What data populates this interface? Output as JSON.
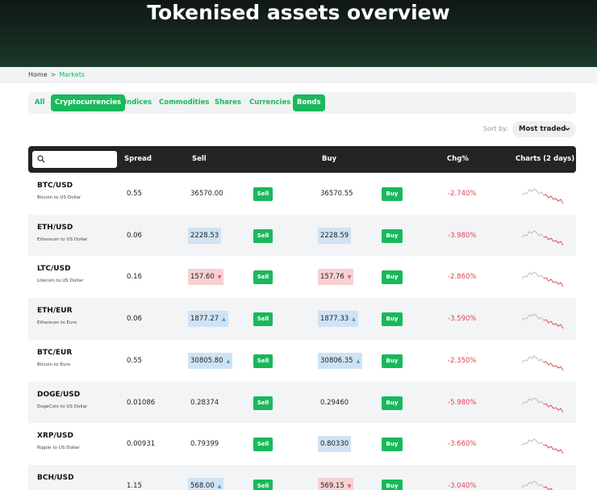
{
  "header": {
    "title": "Tokenised assets overview"
  },
  "breadcrumb": {
    "home": "Home",
    "separator": ">",
    "current": "Markets"
  },
  "tabs": [
    {
      "label": "All",
      "selected": false
    },
    {
      "label": "Cryptocurrencies",
      "selected": true
    },
    {
      "label": "Indices",
      "selected": false
    },
    {
      "label": "Commodities",
      "selected": false
    },
    {
      "label": "Shares",
      "selected": false
    },
    {
      "label": "Currencies",
      "selected": false
    },
    {
      "label": "Bonds",
      "selected": true
    }
  ],
  "sort": {
    "label": "Sort by:",
    "value": "Most traded",
    "icon": "chevron-down-icon"
  },
  "search": {
    "placeholder": "",
    "icon": "search-icon"
  },
  "columns": {
    "spread": "Spread",
    "sell": "Sell",
    "buy": "Buy",
    "chg": "Chg%",
    "charts": "Charts (2 days)"
  },
  "colors": {
    "accent": "#19b85b",
    "negative": "#e2434f",
    "up_highlight": "#cfe3f4",
    "down_highlight": "#f8d0d2"
  },
  "rows": [
    {
      "symbol": "BTC/USD",
      "description": "Bitcoin to US Dollar",
      "spread": "0.55",
      "sell": "36570.00",
      "sell_trend": "none",
      "sell_button": "Sell",
      "buy": "36570.55",
      "buy_trend": "none",
      "buy_button": "Buy",
      "chg": "-2.740%"
    },
    {
      "symbol": "ETH/USD",
      "description": "Ethereum to US Dollar",
      "spread": "0.06",
      "sell": "2228.53",
      "sell_trend": "flat",
      "sell_button": "Sell",
      "buy": "2228.59",
      "buy_trend": "flat",
      "buy_button": "Buy",
      "chg": "-3.980%"
    },
    {
      "symbol": "LTC/USD",
      "description": "Litecoin to US Dollar",
      "spread": "0.16",
      "sell": "157.60",
      "sell_trend": "down",
      "sell_button": "Sell",
      "buy": "157.76",
      "buy_trend": "down",
      "buy_button": "Buy",
      "chg": "-2.860%"
    },
    {
      "symbol": "ETH/EUR",
      "description": "Ethereum to Euro",
      "spread": "0.06",
      "sell": "1877.27",
      "sell_trend": "up",
      "sell_button": "Sell",
      "buy": "1877.33",
      "buy_trend": "up",
      "buy_button": "Buy",
      "chg": "-3.590%"
    },
    {
      "symbol": "BTC/EUR",
      "description": "Bitcoin to Euro",
      "spread": "0.55",
      "sell": "30805.80",
      "sell_trend": "up",
      "sell_button": "Sell",
      "buy": "30806.35",
      "buy_trend": "up",
      "buy_button": "Buy",
      "chg": "-2.350%"
    },
    {
      "symbol": "DOGE/USD",
      "description": "DogeCoin to US Dollar",
      "spread": "0.01086",
      "sell": "0.28374",
      "sell_trend": "none",
      "sell_button": "Sell",
      "buy": "0.29460",
      "buy_trend": "none",
      "buy_button": "Buy",
      "chg": "-5.980%"
    },
    {
      "symbol": "XRP/USD",
      "description": "Ripple to US Dollar",
      "spread": "0.00931",
      "sell": "0.79399",
      "sell_trend": "none",
      "sell_button": "Sell",
      "buy": "0.80330",
      "buy_trend": "flat",
      "buy_button": "Buy",
      "chg": "-3.660%"
    },
    {
      "symbol": "BCH/USD",
      "description": "",
      "spread": "1.15",
      "sell": "568.00",
      "sell_trend": "up",
      "sell_button": "Sell",
      "buy": "569.15",
      "buy_trend": "down",
      "buy_button": "Buy",
      "chg": "-3.040%"
    }
  ]
}
